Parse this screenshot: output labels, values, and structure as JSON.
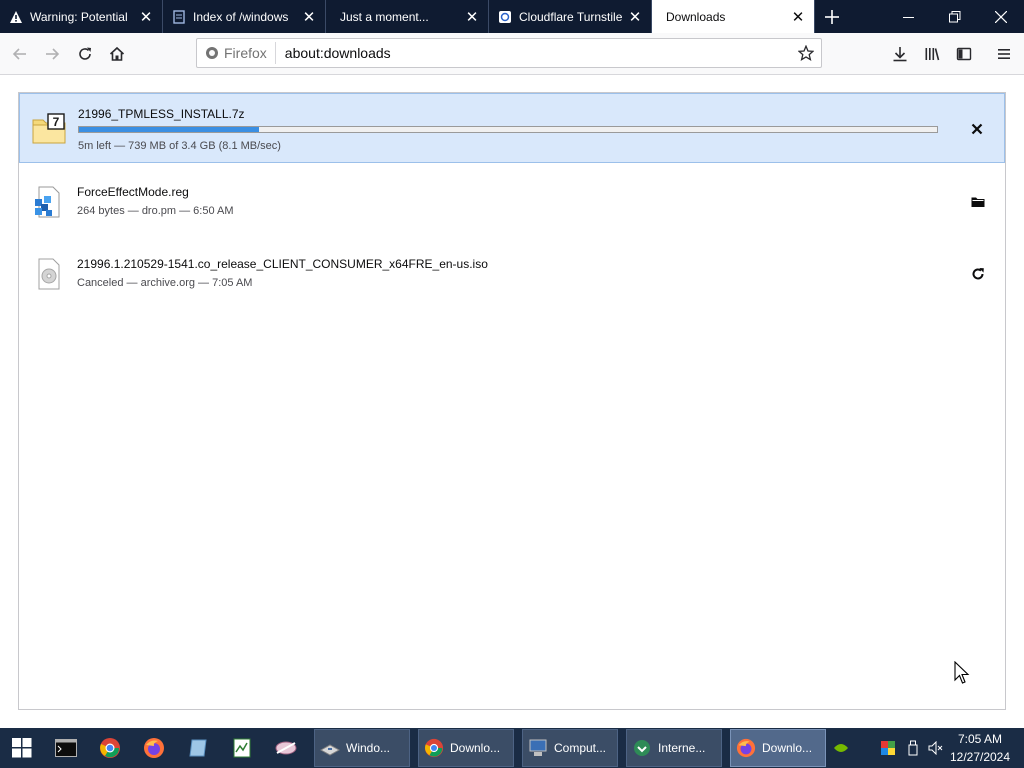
{
  "browser": {
    "tabs": [
      {
        "title": "Warning: Potential",
        "icon": "warning-icon"
      },
      {
        "title": "Index of /windows",
        "icon": "page-icon"
      },
      {
        "title": "Just a moment...",
        "icon": "none"
      },
      {
        "title": "Cloudflare Turnstile",
        "icon": "turnstile-icon"
      },
      {
        "title": "Downloads",
        "icon": "none",
        "selected": true
      }
    ],
    "identity_label": "Firefox",
    "url": "about:downloads"
  },
  "downloads": [
    {
      "name": "21996_TPMLESS_INSTALL.7z",
      "status": "5m left — 739 MB of 3.4 GB (8.1 MB/sec)",
      "progress_percent": 21,
      "icon": "7z-archive-icon",
      "action": "cancel-icon",
      "state": "downloading"
    },
    {
      "name": "ForceEffectMode.reg",
      "status": "264 bytes — dro.pm — 6:50 AM",
      "icon": "registry-file-icon",
      "action": "folder-icon",
      "state": "finished"
    },
    {
      "name": "21996.1.210529-1541.co_release_CLIENT_CONSUMER_x64FRE_en-us.iso",
      "status": "Canceled — archive.org — 7:05 AM",
      "icon": "disc-image-icon",
      "action": "retry-icon",
      "state": "canceled"
    }
  ],
  "taskbar": {
    "pinned": [
      "start-icon",
      "cmd-icon",
      "chrome-icon",
      "firefox-icon",
      "notepad-icon",
      "spreadsheet-icon",
      "network-icon"
    ],
    "tasks": [
      {
        "label": "Windo...",
        "icon": "explorer-icon"
      },
      {
        "label": "Downlo...",
        "icon": "chrome-icon"
      },
      {
        "label": "Comput...",
        "icon": "computer-icon"
      },
      {
        "label": "Interne...",
        "icon": "internet-download-icon"
      },
      {
        "label": "Downlo...",
        "icon": "firefox-icon",
        "active": true
      }
    ],
    "clock_time": "7:05 AM",
    "clock_date": "12/27/2024"
  },
  "colors": {
    "tabstrip_bg": "#0f1b31",
    "selected_download_bg": "#d9e8fb",
    "progress_fill": "#3a8fe3",
    "taskbar_bg": "#1a2c45"
  }
}
